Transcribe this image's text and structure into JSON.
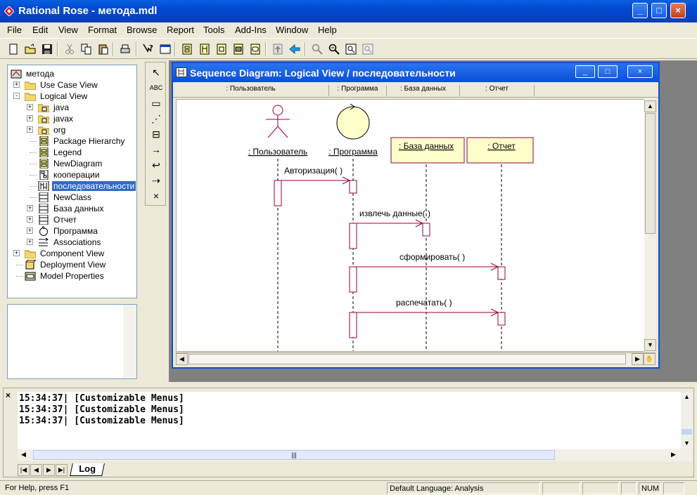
{
  "app": {
    "title": "Rational Rose - метода.mdl",
    "controls": {
      "minimize": "_",
      "maximize": "□",
      "close": "×"
    }
  },
  "menu": [
    {
      "label": "File",
      "id": "file"
    },
    {
      "label": "Edit",
      "id": "edit"
    },
    {
      "label": "View",
      "id": "view"
    },
    {
      "label": "Format",
      "id": "format"
    },
    {
      "label": "Browse",
      "id": "browse"
    },
    {
      "label": "Report",
      "id": "report"
    },
    {
      "label": "Tools",
      "id": "tools"
    },
    {
      "label": "Add-Ins",
      "id": "add-ins"
    },
    {
      "label": "Window",
      "id": "window"
    },
    {
      "label": "Help",
      "id": "help"
    }
  ],
  "toolbar_icons": [
    "new-icon",
    "open-icon",
    "save-icon",
    "cut-icon",
    "copy-icon",
    "paste-icon",
    "print-icon",
    "context-help-icon",
    "view-doc-icon",
    "class-diagram-icon",
    "interaction-diagram-icon",
    "component-diagram-icon",
    "deployment-diagram-icon",
    "state-diagram-icon",
    "browse-parent-icon",
    "previous-diagram-icon",
    "zoom-in-icon",
    "zoom-out-icon",
    "fit-window-icon",
    "undo-fit-icon"
  ],
  "browser": {
    "root": "метода",
    "nodes": [
      {
        "label": "Use Case View",
        "depth": 1,
        "expand": "+",
        "icon": "folder-icon"
      },
      {
        "label": "Logical View",
        "depth": 1,
        "expand": "-",
        "icon": "folder-icon"
      },
      {
        "label": "java",
        "depth": 2,
        "expand": "+",
        "icon": "package-folder-icon"
      },
      {
        "label": "javax",
        "depth": 2,
        "expand": "+",
        "icon": "package-folder-icon"
      },
      {
        "label": "org",
        "depth": 2,
        "expand": "+",
        "icon": "package-folder-icon"
      },
      {
        "label": "Package Hierarchy",
        "depth": 2,
        "expand": "",
        "icon": "class-diagram-icon"
      },
      {
        "label": "Legend",
        "depth": 2,
        "expand": "",
        "icon": "class-diagram-icon"
      },
      {
        "label": "NewDiagram",
        "depth": 2,
        "expand": "",
        "icon": "class-diagram-icon"
      },
      {
        "label": "кооперации",
        "depth": 2,
        "expand": "",
        "icon": "collaboration-diagram-icon"
      },
      {
        "label": "последовательности",
        "depth": 2,
        "expand": "",
        "icon": "sequence-diagram-icon",
        "selected": true
      },
      {
        "label": "NewClass",
        "depth": 2,
        "expand": "",
        "icon": "class-icon"
      },
      {
        "label": "База данных",
        "depth": 2,
        "expand": "+",
        "icon": "class-icon"
      },
      {
        "label": "Отчет",
        "depth": 2,
        "expand": "+",
        "icon": "class-icon"
      },
      {
        "label": "Программа",
        "depth": 2,
        "expand": "+",
        "icon": "control-class-icon"
      },
      {
        "label": "Associations",
        "depth": 2,
        "expand": "+",
        "icon": "associations-icon"
      },
      {
        "label": "Component View",
        "depth": 1,
        "expand": "+",
        "icon": "folder-icon"
      },
      {
        "label": "Deployment View",
        "depth": 1,
        "expand": "",
        "icon": "deployment-icon"
      },
      {
        "label": "Model Properties",
        "depth": 1,
        "expand": "",
        "icon": "properties-icon"
      }
    ]
  },
  "toolbox": [
    {
      "name": "selection-tool",
      "glyph": "↖"
    },
    {
      "name": "text-tool",
      "glyph": "ABC"
    },
    {
      "name": "note-tool",
      "glyph": "▭"
    },
    {
      "name": "anchor-tool",
      "glyph": "⋰"
    },
    {
      "name": "object-tool",
      "glyph": "⊟"
    },
    {
      "name": "message-tool",
      "glyph": "→"
    },
    {
      "name": "self-message-tool",
      "glyph": "↩"
    },
    {
      "name": "return-message-tool",
      "glyph": "⇢"
    },
    {
      "name": "destruction-tool",
      "glyph": "×"
    }
  ],
  "diagram": {
    "title": "Sequence Diagram: Logical View / последовательности",
    "objects": [
      {
        "header": ": Пользователь",
        "label": ": Пользователь",
        "kind": "actor"
      },
      {
        "header": ": Программа",
        "label": ": Программа",
        "kind": "control"
      },
      {
        "header": ": База данных",
        "label": ": База данных",
        "kind": "object"
      },
      {
        "header": ": Отчет",
        "label": ": Отчет",
        "kind": "object"
      }
    ],
    "messages": [
      {
        "label": "Авторизация( )",
        "from": 0,
        "to": 1
      },
      {
        "label": "извлечь данные( )",
        "from": 1,
        "to": 2
      },
      {
        "label": "сформировать( )",
        "from": 1,
        "to": 3
      },
      {
        "label": "распечатать( )",
        "from": 1,
        "to": 3
      }
    ]
  },
  "log": {
    "lines": [
      "15:34:37|  [Customizable Menus]",
      "15:34:37|  [Customizable Menus]",
      "15:34:37|  [Customizable Menus]"
    ],
    "tab": "Log",
    "close": "×"
  },
  "status": {
    "help": "For Help, press F1",
    "language": "Default Language: Analysis",
    "num": "NUM"
  }
}
